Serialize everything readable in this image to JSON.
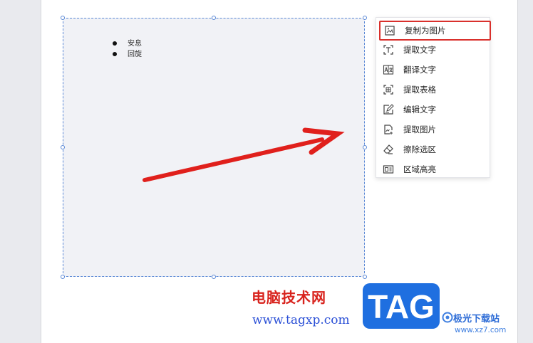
{
  "document": {
    "list_items": [
      "安息",
      "回旋"
    ]
  },
  "context_menu": {
    "items": [
      {
        "label": "复制为图片",
        "icon": "copy-as-image-icon",
        "highlighted": true
      },
      {
        "label": "提取文字",
        "icon": "extract-text-icon",
        "highlighted": false
      },
      {
        "label": "翻译文字",
        "icon": "translate-text-icon",
        "highlighted": false
      },
      {
        "label": "提取表格",
        "icon": "extract-table-icon",
        "highlighted": false
      },
      {
        "label": "编辑文字",
        "icon": "edit-text-icon",
        "highlighted": false
      },
      {
        "label": "提取图片",
        "icon": "extract-image-icon",
        "highlighted": false
      },
      {
        "label": "擦除选区",
        "icon": "eraser-icon",
        "highlighted": false
      },
      {
        "label": "区域高亮",
        "icon": "highlight-area-icon",
        "highlighted": false
      }
    ]
  },
  "watermark": {
    "site_name": "电脑技术网",
    "site_url": "www.tagxp.com",
    "badge_text": "TAG",
    "right_title": "极光下载站",
    "right_url": "www.xz7.com"
  },
  "colors": {
    "accent_red": "#d9302c",
    "selection_border": "#5a88d6",
    "badge_blue": "#1f6fe0"
  }
}
